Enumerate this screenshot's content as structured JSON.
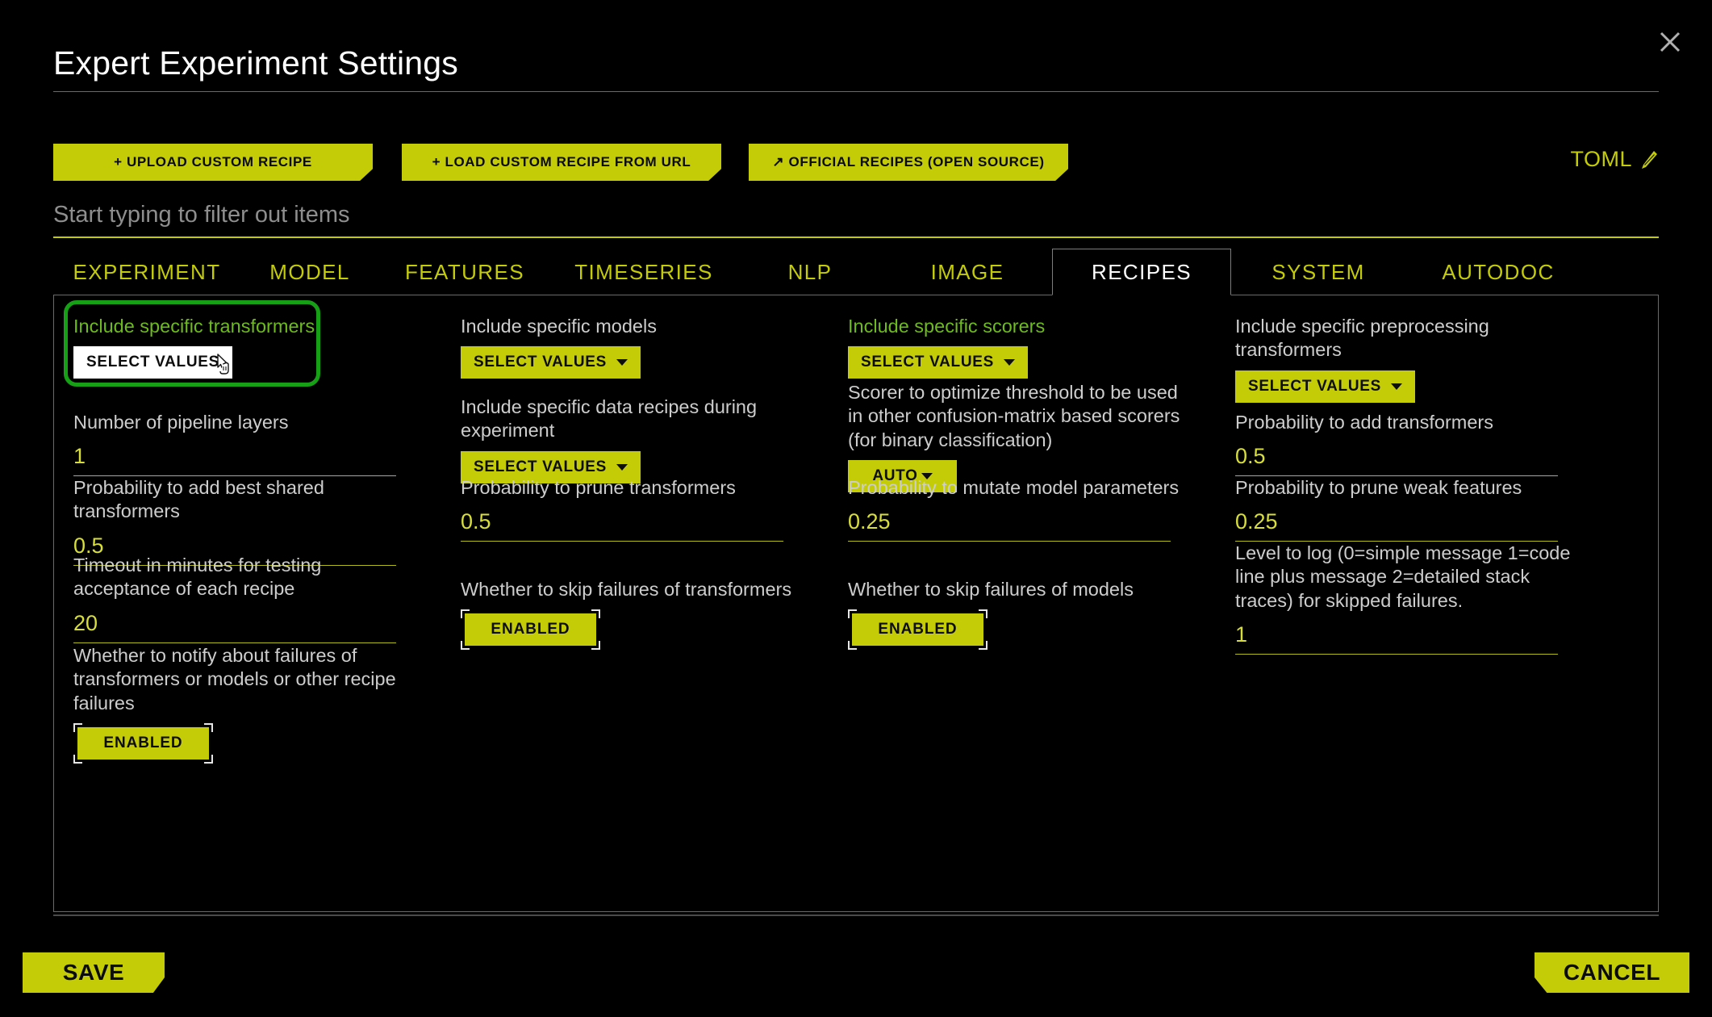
{
  "window": {
    "title": "Expert Experiment Settings",
    "close_label": "close-icon"
  },
  "toolbar": {
    "upload_recipe": "+ UPLOAD CUSTOM RECIPE",
    "load_recipe_url": "+ LOAD CUSTOM RECIPE FROM URL",
    "official_recipes": "↗ OFFICIAL RECIPES (OPEN SOURCE)",
    "toml_label": "TOML"
  },
  "filter": {
    "placeholder": "Start typing to filter out items",
    "value": ""
  },
  "tabs": [
    {
      "label": "EXPERIMENT",
      "active": false
    },
    {
      "label": "MODEL",
      "active": false
    },
    {
      "label": "FEATURES",
      "active": false
    },
    {
      "label": "TIMESERIES",
      "active": false
    },
    {
      "label": "NLP",
      "active": false
    },
    {
      "label": "IMAGE",
      "active": false
    },
    {
      "label": "RECIPES",
      "active": true
    },
    {
      "label": "SYSTEM",
      "active": false
    },
    {
      "label": "AUTODOC",
      "active": false
    }
  ],
  "fields": {
    "include_specific_transformers": {
      "label": "Include specific transformers",
      "control": "SELECT VALUES",
      "highlighted": true,
      "changed": true
    },
    "number_of_pipeline_layers": {
      "label": "Number of pipeline layers",
      "value": "1"
    },
    "prob_add_best_shared_transformers": {
      "label": "Probability to add best shared transformers",
      "value": "0.5"
    },
    "timeout_minutes_recipe": {
      "label": "Timeout in minutes for testing acceptance of each recipe",
      "value": "20"
    },
    "notify_about_failures": {
      "label": "Whether to notify about failures of transformers or models or other recipe failures",
      "value": "ENABLED"
    },
    "include_specific_models": {
      "label": "Include specific models",
      "control": "SELECT VALUES"
    },
    "include_specific_data_recipes": {
      "label": "Include specific data recipes during experiment",
      "control": "SELECT VALUES"
    },
    "prob_prune_transformers": {
      "label": "Probability to prune transformers",
      "value": "0.5"
    },
    "skip_failures_transformers": {
      "label": "Whether to skip failures of transformers",
      "value": "ENABLED"
    },
    "include_specific_scorers": {
      "label": "Include specific scorers",
      "control": "SELECT VALUES",
      "changed": true
    },
    "scorer_optimize_threshold": {
      "label": "Scorer to optimize threshold to be used in other confusion-matrix based scorers (for binary classification)",
      "control": "AUTO"
    },
    "prob_mutate_model_parameters": {
      "label": "Probability to mutate model parameters",
      "value": "0.25"
    },
    "skip_failures_models": {
      "label": "Whether to skip failures of models",
      "value": "ENABLED"
    },
    "include_specific_preprocessing": {
      "label": "Include specific preprocessing transformers",
      "control": "SELECT VALUES"
    },
    "prob_add_transformers": {
      "label": "Probability to add transformers",
      "value": "0.5"
    },
    "prob_prune_weak_features": {
      "label": "Probability to prune weak features",
      "value": "0.25"
    },
    "level_to_log": {
      "label": "Level to log (0=simple message 1=code line plus message 2=detailed stack traces) for skipped failures.",
      "value": "1"
    }
  },
  "footer": {
    "save": "SAVE",
    "cancel": "CANCEL"
  },
  "colors": {
    "accent_yellow": "#c4cc08",
    "highlight_green": "#16a016",
    "changed_label_green": "#6dbb1e",
    "background": "#000000",
    "text": "#cdcdcd",
    "value_text": "#d7de3a"
  }
}
